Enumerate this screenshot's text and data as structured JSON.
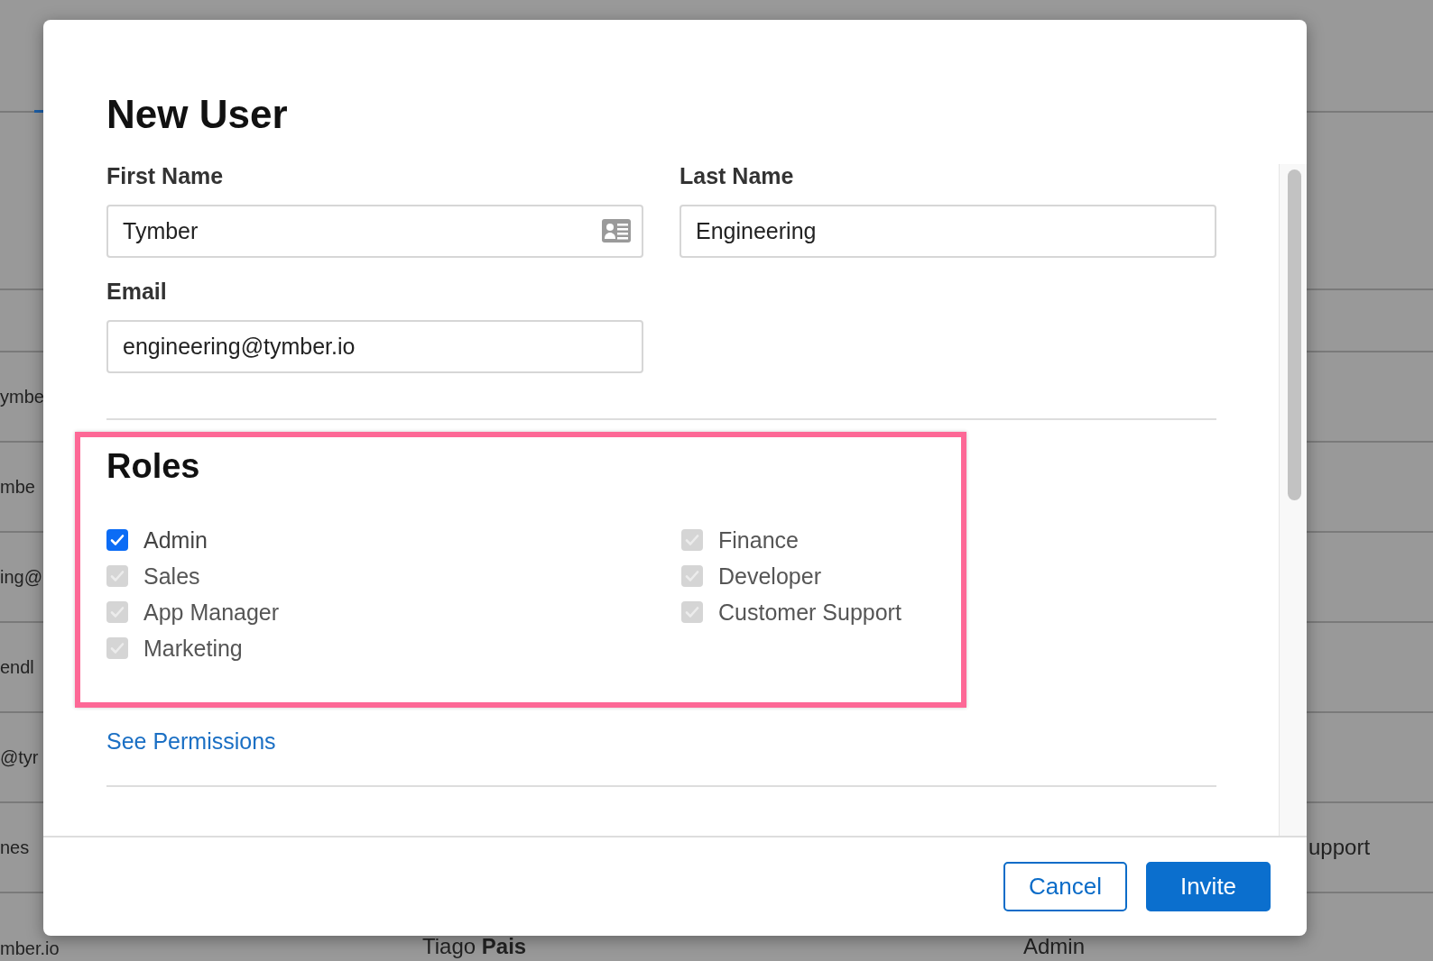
{
  "background": {
    "rows": [
      {
        "column_1": "ymbe"
      },
      {
        "column_1": "mbe"
      },
      {
        "column_1": "ing@"
      },
      {
        "column_1": "endl"
      },
      {
        "column_1": "@tyr"
      },
      {
        "column_1": "nes",
        "column_3": "upport"
      },
      {
        "column_1": "mber.io",
        "column_2": "Tiago **Pais**",
        "column_3": "Admin"
      }
    ]
  },
  "dialog": {
    "title": "New User",
    "fields": [
      {
        "label": "First Name",
        "value": "Tymber",
        "kind": "contact"
      },
      {
        "label": "Last Name",
        "value": "Engineering",
        "kind": "plain"
      },
      {
        "label": "Email",
        "value": "engineering@tymber.io",
        "kind": "plain"
      }
    ],
    "roles": {
      "title": "Roles",
      "highlighted": true,
      "items": [
        {
          "label": "Admin",
          "checked": true,
          "disabled": false
        },
        {
          "label": "Sales",
          "checked": true,
          "disabled": true
        },
        {
          "label": "App Manager",
          "checked": true,
          "disabled": true
        },
        {
          "label": "Marketing",
          "checked": true,
          "disabled": true
        },
        {
          "label": "Finance",
          "checked": true,
          "disabled": true
        },
        {
          "label": "Developer",
          "checked": true,
          "disabled": true
        },
        {
          "label": "Customer Support",
          "checked": true,
          "disabled": true
        }
      ]
    },
    "link": "See Permissions",
    "buttons": [
      {
        "label": "Cancel",
        "kind": "secondary"
      },
      {
        "label": "Invite",
        "kind": "primary"
      }
    ]
  }
}
